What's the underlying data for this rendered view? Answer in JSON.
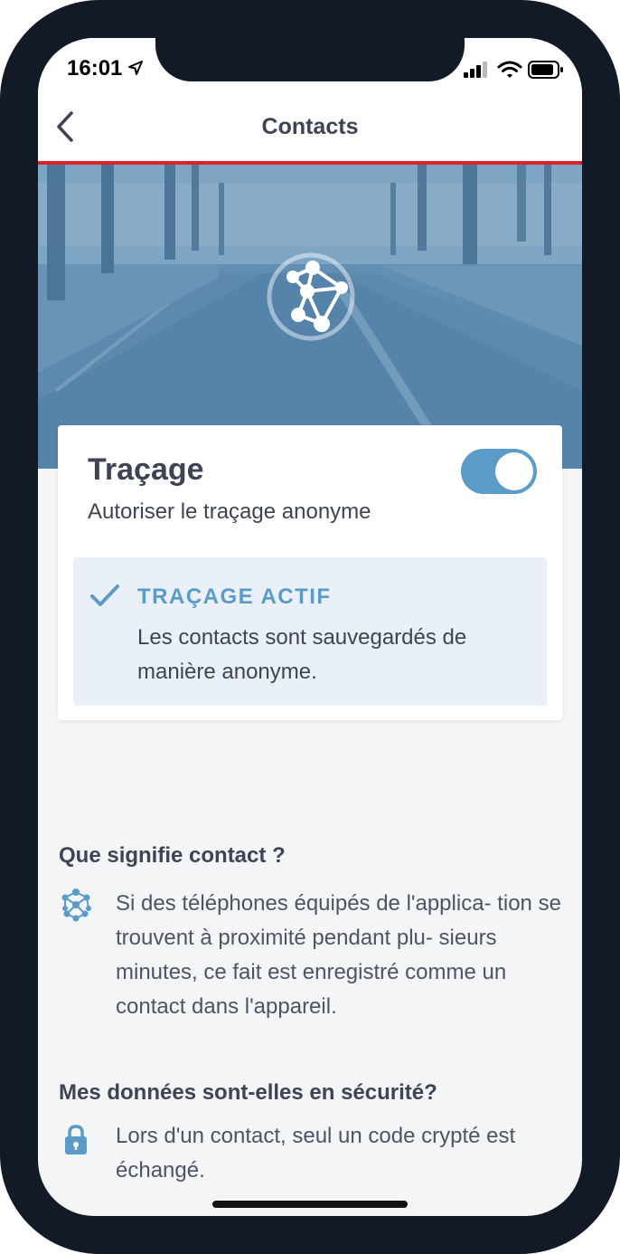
{
  "status_bar": {
    "time": "16:01",
    "icons": [
      "location-arrow-icon",
      "signal-icon",
      "wifi-icon",
      "battery-icon"
    ]
  },
  "nav": {
    "title": "Contacts",
    "back_icon": "chevron-left-icon"
  },
  "hero": {
    "logo_icon": "network-nodes-icon"
  },
  "tracing_card": {
    "title": "Traçage",
    "subtitle": "Autoriser le traçage anonyme",
    "toggle_on": true,
    "status": {
      "icon": "checkmark-icon",
      "title": "TRAÇAGE ACTIF",
      "text": "Les contacts sont sauvegardés de manière anonyme."
    }
  },
  "faq": [
    {
      "title": "Que signifie contact ?",
      "icon": "network-nodes-icon",
      "text": "Si des téléphones équipés de l'applica- tion se trouvent à proximité pendant plu- sieurs minutes, ce fait est enregistré comme un contact dans l'appareil."
    },
    {
      "title": "Mes données sont-elles en sécurité?",
      "icon": "lock-icon",
      "text": "Lors d'un contact, seul un code crypté est échangé."
    }
  ],
  "colors": {
    "accent": "#5a9bc7",
    "nav_divider": "#d9232d",
    "text_primary": "#3e4356",
    "status_box_bg": "#eaf0f7",
    "page_bg": "#f4f5f7",
    "device_frame": "#121a28"
  }
}
